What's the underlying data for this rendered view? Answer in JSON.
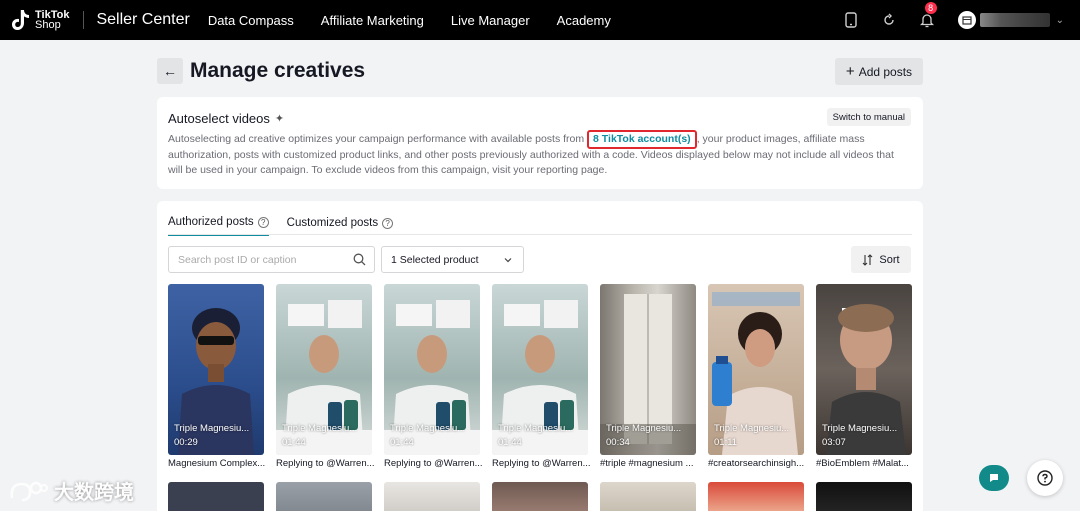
{
  "nav": {
    "logo_line1": "TikTok",
    "logo_line2": "Shop",
    "brand": "Seller Center",
    "items": [
      "Data Compass",
      "Affiliate Marketing",
      "Live Manager",
      "Academy"
    ],
    "notification_count": "8"
  },
  "page": {
    "title": "Manage creatives",
    "add_posts_label": "Add posts"
  },
  "autoselect": {
    "title": "Autoselect videos",
    "switch_label": "Switch to manual",
    "desc_before": "Autoselecting ad creative optimizes your campaign performance with available posts from ",
    "accounts_link": "8 TikTok account(s)",
    "desc_after": ", your product images, affiliate mass authorization, posts with customized product links, and other posts previously authorized with a code. Videos displayed below may not include all videos that will be used in your campaign. To exclude videos from this campaign, visit your reporting page."
  },
  "posts": {
    "tabs": [
      "Authorized posts",
      "Customized posts"
    ],
    "search_placeholder": "Search post ID or caption",
    "product_selector": "1 Selected product",
    "sort_label": "Sort",
    "items": [
      {
        "caption": "Triple Magnesiu...",
        "duration": "00:29",
        "label": "Magnesium Complex..."
      },
      {
        "caption": "Triple Magnesiu...",
        "duration": "01:44",
        "label": "Replying to @Warren..."
      },
      {
        "caption": "Triple Magnesiu...",
        "duration": "01:44",
        "label": "Replying to @Warren..."
      },
      {
        "caption": "Triple Magnesiu...",
        "duration": "01:44",
        "label": "Replying to @Warren..."
      },
      {
        "caption": "Triple Magnesiu...",
        "duration": "00:34",
        "label": "#triple #magnesium ..."
      },
      {
        "caption": "Triple Magnesiu...",
        "duration": "01:11",
        "label": "#creatorsearchinsigh..."
      },
      {
        "caption": "Triple Magnesiu...",
        "duration": "03:07",
        "label": "#BioEmblem #Malat..."
      }
    ]
  },
  "watermark": "大数跨境",
  "colors": {
    "accent": "#0e8ea0",
    "highlight_border": "#e0282e",
    "nav_bg": "#000000",
    "badge": "#ff2e4d",
    "chat": "#138a8a"
  }
}
